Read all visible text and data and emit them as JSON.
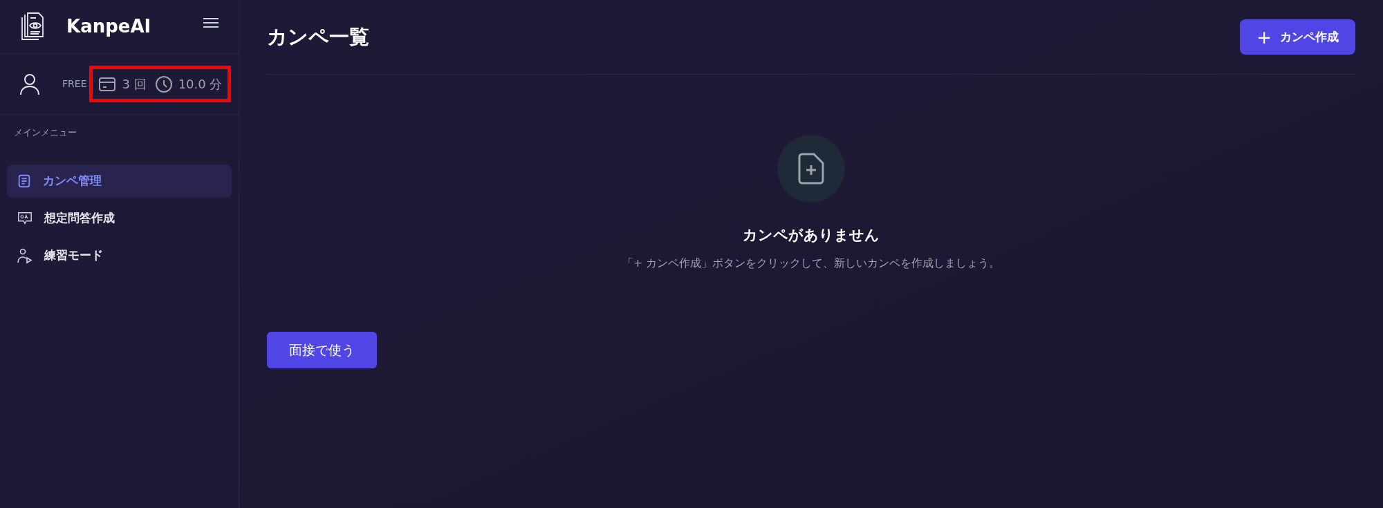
{
  "sidebar": {
    "brand": "KanpeAI",
    "user": {
      "plan": "FREE",
      "highlighted": true,
      "usage": [
        {
          "kind": "count",
          "value": "3 回"
        },
        {
          "kind": "time",
          "value": "10.0 分"
        }
      ]
    },
    "section_label": "メインメニュー",
    "items": [
      {
        "kind": "doc",
        "label": "カンペ管理",
        "selected": true
      },
      {
        "kind": "qa",
        "label": "想定問答作成",
        "selected": false
      },
      {
        "kind": "practice",
        "label": "練習モード",
        "selected": false
      }
    ]
  },
  "main": {
    "title": "カンペ一覧",
    "create_button": {
      "icon": "+",
      "label": "カンペ作成"
    },
    "empty": {
      "title": "カンペがありません",
      "message": "「+ カンペ作成」ボタンをクリックして、新しいカンペを作成しましょう。"
    },
    "interview_button": "面接で使う"
  }
}
